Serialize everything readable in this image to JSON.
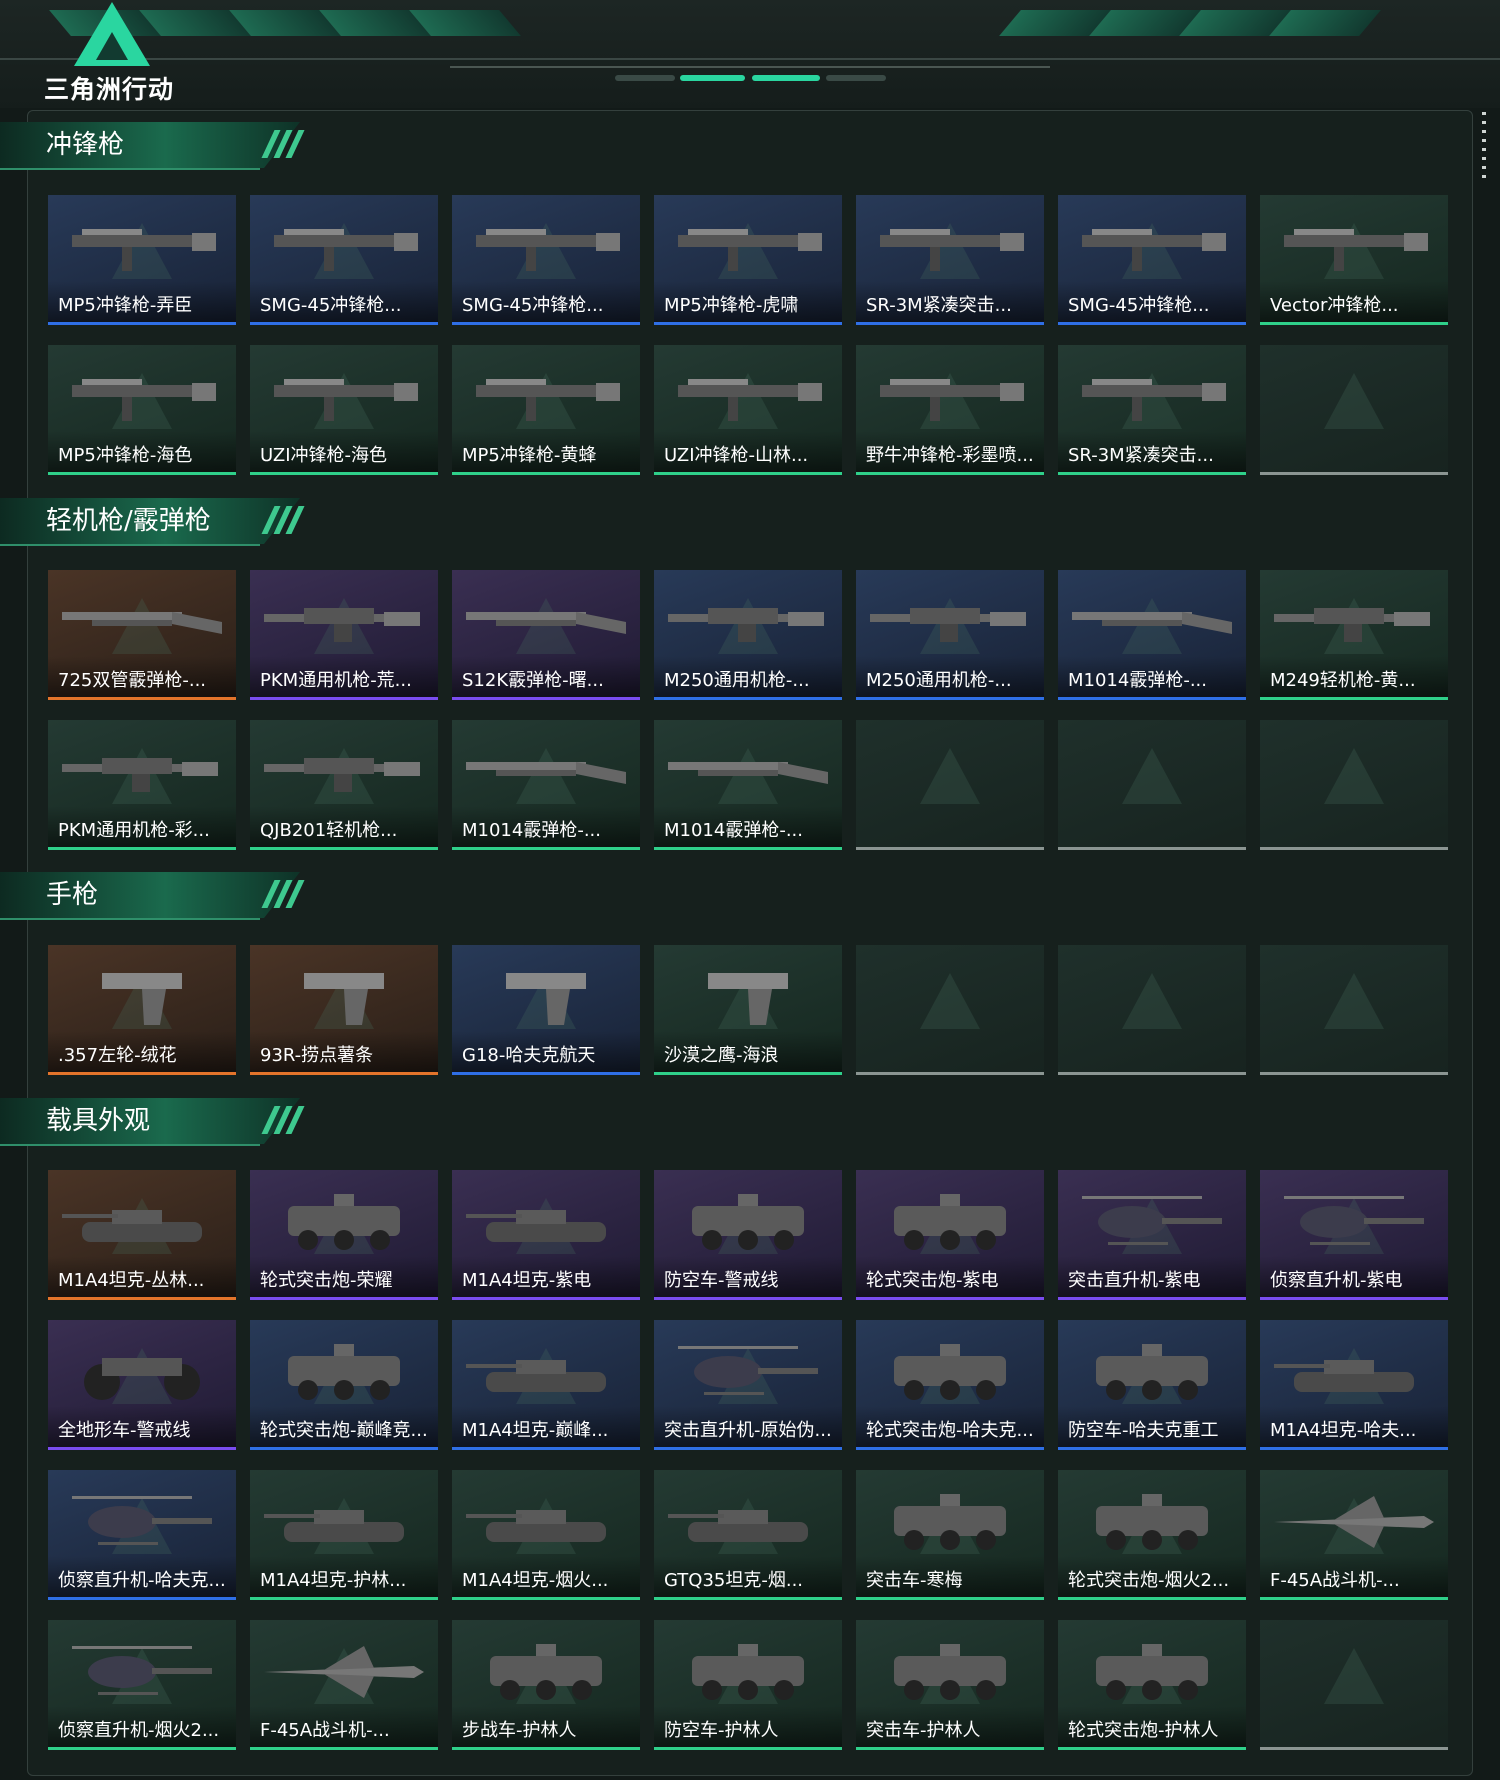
{
  "app": {
    "logo_text": "三角洲行动"
  },
  "colors": {
    "purple": "#7a4cf0",
    "orange": "#e3742b",
    "blue": "#2f6fe6",
    "green": "#2fd08a",
    "empty": "#8b9592"
  },
  "sections": [
    {
      "title": "冲锋枪",
      "items": [
        {
          "label": "MP5冲锋枪-弄臣",
          "rarity": "blue",
          "icon": "smg-icon"
        },
        {
          "label": "SMG-45冲锋枪...",
          "rarity": "blue",
          "icon": "smg-icon"
        },
        {
          "label": "SMG-45冲锋枪...",
          "rarity": "blue",
          "icon": "smg-icon"
        },
        {
          "label": "MP5冲锋枪-虎啸",
          "rarity": "blue",
          "icon": "smg-icon"
        },
        {
          "label": "SR-3M紧凑突击...",
          "rarity": "blue",
          "icon": "smg-icon"
        },
        {
          "label": "SMG-45冲锋枪...",
          "rarity": "blue",
          "icon": "smg-icon"
        },
        {
          "label": "Vector冲锋枪...",
          "rarity": "green",
          "icon": "smg-icon"
        },
        {
          "label": "MP5冲锋枪-海色",
          "rarity": "green",
          "icon": "smg-icon"
        },
        {
          "label": "UZI冲锋枪-海色",
          "rarity": "green",
          "icon": "smg-icon"
        },
        {
          "label": "MP5冲锋枪-黄蜂",
          "rarity": "green",
          "icon": "smg-icon"
        },
        {
          "label": "UZI冲锋枪-山林...",
          "rarity": "green",
          "icon": "smg-icon"
        },
        {
          "label": "野牛冲锋枪-彩墨喷...",
          "rarity": "green",
          "icon": "smg-icon"
        },
        {
          "label": "SR-3M紧凑突击...",
          "rarity": "green",
          "icon": "smg-icon"
        },
        {
          "label": "",
          "rarity": "empty",
          "icon": "empty-slot-icon"
        }
      ]
    },
    {
      "title": "轻机枪/霰弹枪",
      "items": [
        {
          "label": "725双管霰弹枪-...",
          "rarity": "orange",
          "icon": "shotgun-icon"
        },
        {
          "label": "PKM通用机枪-荒...",
          "rarity": "purple",
          "icon": "lmg-icon"
        },
        {
          "label": "S12K霰弹枪-曙...",
          "rarity": "purple",
          "icon": "shotgun-icon"
        },
        {
          "label": "M250通用机枪-...",
          "rarity": "blue",
          "icon": "lmg-icon"
        },
        {
          "label": "M250通用机枪-...",
          "rarity": "blue",
          "icon": "lmg-icon"
        },
        {
          "label": "M1014霰弹枪-...",
          "rarity": "blue",
          "icon": "shotgun-icon"
        },
        {
          "label": "M249轻机枪-黄...",
          "rarity": "green",
          "icon": "lmg-icon"
        },
        {
          "label": "PKM通用机枪-彩...",
          "rarity": "green",
          "icon": "lmg-icon"
        },
        {
          "label": "QJB201轻机枪...",
          "rarity": "green",
          "icon": "lmg-icon"
        },
        {
          "label": "M1014霰弹枪-...",
          "rarity": "green",
          "icon": "shotgun-icon"
        },
        {
          "label": "M1014霰弹枪-...",
          "rarity": "green",
          "icon": "shotgun-icon"
        },
        {
          "label": "",
          "rarity": "empty",
          "icon": "empty-slot-icon"
        },
        {
          "label": "",
          "rarity": "empty",
          "icon": "empty-slot-icon"
        },
        {
          "label": "",
          "rarity": "empty",
          "icon": "empty-slot-icon"
        }
      ]
    },
    {
      "title": "手枪",
      "items": [
        {
          "label": ".357左轮-绒花",
          "rarity": "orange",
          "icon": "pistol-icon"
        },
        {
          "label": "93R-捞点薯条",
          "rarity": "orange",
          "icon": "pistol-icon"
        },
        {
          "label": "G18-哈夫克航天",
          "rarity": "blue",
          "icon": "pistol-icon"
        },
        {
          "label": "沙漠之鹰-海浪",
          "rarity": "green",
          "icon": "pistol-icon"
        },
        {
          "label": "",
          "rarity": "empty",
          "icon": "empty-slot-icon"
        },
        {
          "label": "",
          "rarity": "empty",
          "icon": "empty-slot-icon"
        },
        {
          "label": "",
          "rarity": "empty",
          "icon": "empty-slot-icon"
        }
      ]
    },
    {
      "title": "载具外观",
      "items": [
        {
          "label": "M1A4坦克-丛林...",
          "rarity": "orange",
          "icon": "tank-icon"
        },
        {
          "label": "轮式突击炮-荣耀",
          "rarity": "purple",
          "icon": "armored-car-icon"
        },
        {
          "label": "M1A4坦克-紫电",
          "rarity": "purple",
          "icon": "tank-icon"
        },
        {
          "label": "防空车-警戒线",
          "rarity": "purple",
          "icon": "armored-car-icon"
        },
        {
          "label": "轮式突击炮-紫电",
          "rarity": "purple",
          "icon": "armored-car-icon"
        },
        {
          "label": "突击直升机-紫电",
          "rarity": "purple",
          "icon": "helicopter-icon"
        },
        {
          "label": "侦察直升机-紫电",
          "rarity": "purple",
          "icon": "helicopter-icon"
        },
        {
          "label": "全地形车-警戒线",
          "rarity": "purple",
          "icon": "atv-icon"
        },
        {
          "label": "轮式突击炮-巅峰竞...",
          "rarity": "blue",
          "icon": "armored-car-icon"
        },
        {
          "label": "M1A4坦克-巅峰...",
          "rarity": "blue",
          "icon": "tank-icon"
        },
        {
          "label": "突击直升机-原始伪...",
          "rarity": "blue",
          "icon": "helicopter-icon"
        },
        {
          "label": "轮式突击炮-哈夫克...",
          "rarity": "blue",
          "icon": "armored-car-icon"
        },
        {
          "label": "防空车-哈夫克重工",
          "rarity": "blue",
          "icon": "armored-car-icon"
        },
        {
          "label": "M1A4坦克-哈夫...",
          "rarity": "blue",
          "icon": "tank-icon"
        },
        {
          "label": "侦察直升机-哈夫克...",
          "rarity": "blue",
          "icon": "helicopter-icon"
        },
        {
          "label": "M1A4坦克-护林...",
          "rarity": "green",
          "icon": "tank-icon"
        },
        {
          "label": "M1A4坦克-烟火...",
          "rarity": "green",
          "icon": "tank-icon"
        },
        {
          "label": "GTQ35坦克-烟...",
          "rarity": "green",
          "icon": "tank-icon"
        },
        {
          "label": "突击车-寒梅",
          "rarity": "green",
          "icon": "armored-car-icon"
        },
        {
          "label": "轮式突击炮-烟火2...",
          "rarity": "green",
          "icon": "armored-car-icon"
        },
        {
          "label": "F-45A战斗机-...",
          "rarity": "green",
          "icon": "jet-icon"
        },
        {
          "label": "侦察直升机-烟火2...",
          "rarity": "green",
          "icon": "helicopter-icon"
        },
        {
          "label": "F-45A战斗机-...",
          "rarity": "green",
          "icon": "jet-icon"
        },
        {
          "label": "步战车-护林人",
          "rarity": "green",
          "icon": "armored-car-icon"
        },
        {
          "label": "防空车-护林人",
          "rarity": "green",
          "icon": "armored-car-icon"
        },
        {
          "label": "突击车-护林人",
          "rarity": "green",
          "icon": "armored-car-icon"
        },
        {
          "label": "轮式突击炮-护林人",
          "rarity": "green",
          "icon": "armored-car-icon"
        },
        {
          "label": "",
          "rarity": "empty",
          "icon": "empty-slot-icon"
        }
      ]
    }
  ]
}
